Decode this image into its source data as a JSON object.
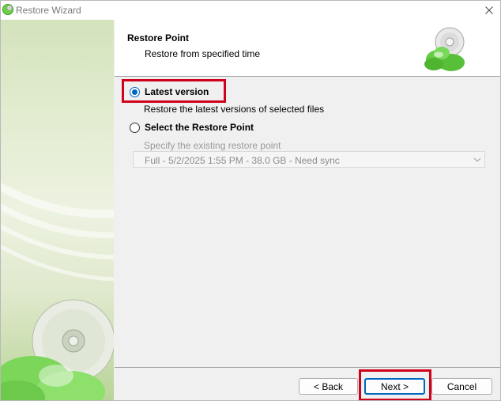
{
  "window": {
    "title": "Restore Wizard",
    "icons": {
      "app": "cloud-app-icon",
      "close": "close-icon",
      "header": "cloud-cd-icon",
      "side": "cd-disc-icon"
    }
  },
  "header": {
    "title": "Restore Point",
    "subtitle": "Restore from specified time"
  },
  "options": {
    "latest": {
      "label": "Latest version",
      "description": "Restore the latest versions of selected files",
      "selected": true
    },
    "restore_point": {
      "label": "Select the Restore Point",
      "description": "Specify the existing restore point",
      "selected": false,
      "dropdown_value": "Full - 5/2/2025 1:55 PM - 38.0 GB - Need sync",
      "enabled": false
    }
  },
  "footer": {
    "back_label": "< Back",
    "next_label": "Next >",
    "cancel_label": "Cancel"
  },
  "colors": {
    "accent": "#0067c0",
    "highlight": "#d0021b",
    "brand_green": "#5cc33a"
  }
}
